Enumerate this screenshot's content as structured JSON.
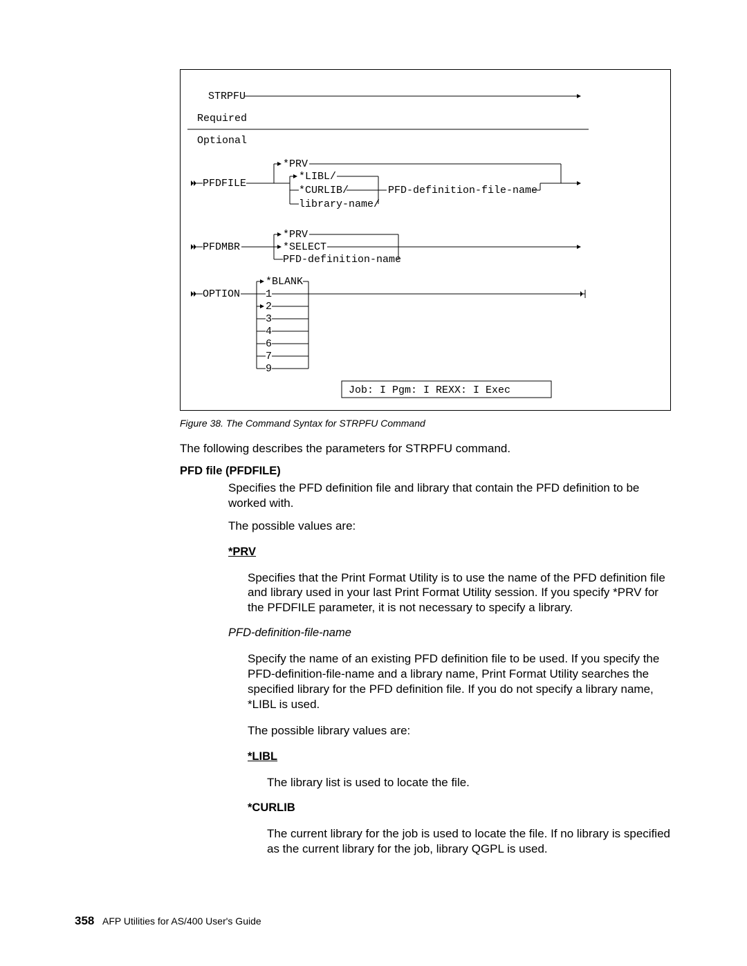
{
  "diagram": {
    "cmd": "STRPFU",
    "required": "Required",
    "optional": "Optional",
    "pfdfile": {
      "kw": "PFDFILE",
      "prv": "*PRV",
      "libl": "*LIBL/",
      "curlib": "*CURLIB/",
      "libname": "library-name/",
      "defname": "PFD-definition-file-name"
    },
    "pfdmbr": {
      "kw": "PFDMBR",
      "prv": "*PRV",
      "select": "*SELECT",
      "defname": "PFD-definition-name"
    },
    "option": {
      "kw": "OPTION",
      "blank": "*BLANK",
      "v1": "1",
      "v2": "2",
      "v3": "3",
      "v4": "4",
      "v6": "6",
      "v7": "7",
      "v9": "9"
    },
    "job_box": "Job: I  Pgm: I   REXX: I  Exec"
  },
  "caption": "Figure 38. The Command Syntax for STRPFU Command",
  "intro": "The following describes the parameters for STRPFU command.",
  "pfdfile_hd": "PFD file (PFDFILE)",
  "pfdfile_desc": "Specifies the PFD definition file and library that contain the PFD definition to be worked with.",
  "possible": "The possible values are:",
  "prv_hd": "*PRV",
  "prv_desc": "Specifies that the Print Format Utility is to use the name of the PFD definition file and library used in your last Print Format Utility session.  If you specify *PRV for the PFDFILE parameter, it is not necessary to specify a library.",
  "defname_hd": "PFD-definition-file-name",
  "defname_desc": "Specify the name of an existing PFD definition file to be used.  If you specify the PFD-definition-file-name and a library name, Print Format Utility searches the specified library for the PFD definition file.  If you do not specify a library name, *LIBL is used.",
  "possible_lib": "The possible library values are:",
  "libl_hd": "*LIBL",
  "libl_desc": "The library list is used to locate the file.",
  "curlib_hd": "*CURLIB",
  "curlib_desc": "The current library for the job is used to locate the file.  If no library is specified as the current library for the job, library QGPL is used.",
  "footer": {
    "pageno": "358",
    "title": "AFP Utilities for AS/400 User's Guide"
  }
}
